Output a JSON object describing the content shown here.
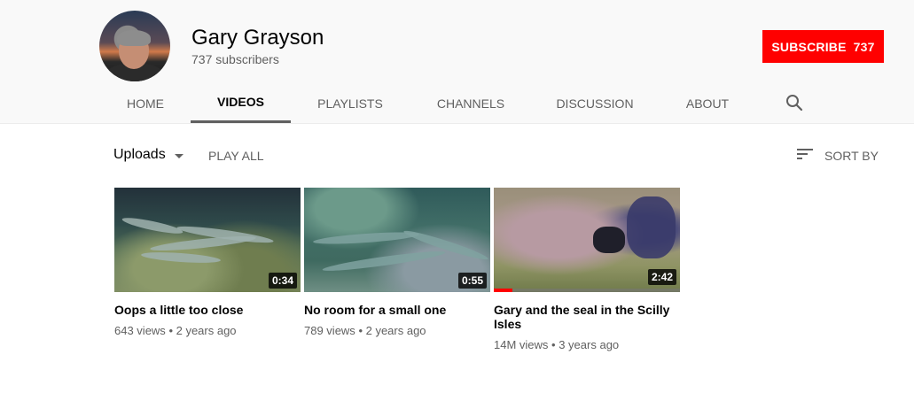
{
  "channel": {
    "name": "Gary Grayson",
    "subscribers_text": "737 subscribers"
  },
  "subscribe": {
    "label": "SUBSCRIBE",
    "count": "737",
    "color": "#ff0000"
  },
  "tabs": [
    {
      "label": "HOME",
      "active": false
    },
    {
      "label": "VIDEOS",
      "active": true
    },
    {
      "label": "PLAYLISTS",
      "active": false
    },
    {
      "label": "CHANNELS",
      "active": false
    },
    {
      "label": "DISCUSSION",
      "active": false
    },
    {
      "label": "ABOUT",
      "active": false
    }
  ],
  "toolbar": {
    "uploads_label": "Uploads",
    "play_all_label": "PLAY ALL",
    "sort_label": "SORT BY"
  },
  "videos": [
    {
      "title": "Oops a little too close",
      "duration": "0:34",
      "views": "643 views",
      "age": "2 years ago"
    },
    {
      "title": "No room for a small one",
      "duration": "0:55",
      "views": "789 views",
      "age": "2 years ago"
    },
    {
      "title": "Gary and the seal in the Scilly Isles",
      "duration": "2:42",
      "views": "14M views",
      "age": "3 years ago",
      "watched_progress": 0.1
    }
  ],
  "icons": {
    "search": "search-icon",
    "sort": "sort-icon",
    "dropdown": "chevron-down-icon"
  }
}
